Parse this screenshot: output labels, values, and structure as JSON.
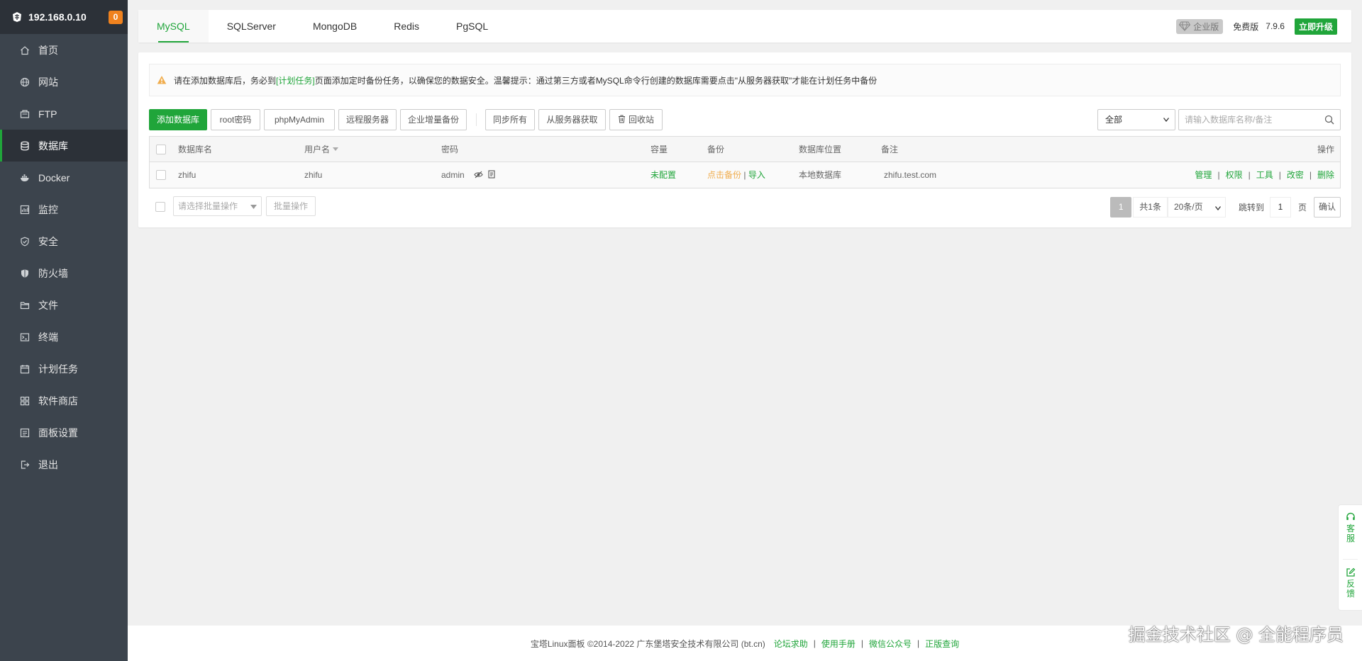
{
  "sidebar": {
    "ip": "192.168.0.10",
    "badge": "0",
    "items": [
      {
        "label": "首页",
        "icon": "home-icon"
      },
      {
        "label": "网站",
        "icon": "globe-icon"
      },
      {
        "label": "FTP",
        "icon": "ftp-icon"
      },
      {
        "label": "数据库",
        "icon": "database-icon",
        "active": true
      },
      {
        "label": "Docker",
        "icon": "docker-icon"
      },
      {
        "label": "监控",
        "icon": "monitor-icon"
      },
      {
        "label": "安全",
        "icon": "shield-icon"
      },
      {
        "label": "防火墙",
        "icon": "firewall-icon"
      },
      {
        "label": "文件",
        "icon": "folder-icon"
      },
      {
        "label": "终端",
        "icon": "terminal-icon"
      },
      {
        "label": "计划任务",
        "icon": "calendar-icon"
      },
      {
        "label": "软件商店",
        "icon": "apps-icon"
      },
      {
        "label": "面板设置",
        "icon": "settings-icon"
      },
      {
        "label": "退出",
        "icon": "logout-icon"
      }
    ]
  },
  "tabs": [
    "MySQL",
    "SQLServer",
    "MongoDB",
    "Redis",
    "PgSQL"
  ],
  "active_tab": "MySQL",
  "topbar": {
    "enterprise_label": "企业版",
    "free_label": "免费版",
    "version": "7.9.6",
    "upgrade_label": "立即升级"
  },
  "alert": {
    "text_before": "请在添加数据库后，务必到",
    "link": "[计划任务]",
    "text_after": "页面添加定时备份任务，以确保您的数据安全。温馨提示：通过第三方或者MySQL命令行创建的数据库需要点击\"从服务器获取\"才能在计划任务中备份"
  },
  "toolbar": {
    "add_db": "添加数据库",
    "root_pwd": "root密码",
    "phpmyadmin": "phpMyAdmin",
    "remote_server": "远程服务器",
    "enterprise_backup": "企业增量备份",
    "sync_all": "同步所有",
    "get_from_server": "从服务器获取",
    "recycle_bin": "回收站",
    "filter_value": "全部",
    "search_placeholder": "请输入数据库名称/备注"
  },
  "table": {
    "headers": {
      "name": "数据库名",
      "user": "用户名",
      "password": "密码",
      "capacity": "容量",
      "backup": "备份",
      "location": "数据库位置",
      "remark": "备注",
      "actions": "操作"
    },
    "rows": [
      {
        "name": "zhifu",
        "user": "zhifu",
        "password": "admin",
        "capacity": "未配置",
        "backup": "点击备份",
        "import": "导入",
        "location": "本地数据库",
        "remark": "zhifu.test.com",
        "ops": [
          "管理",
          "权限",
          "工具",
          "改密",
          "删除"
        ]
      }
    ]
  },
  "batch": {
    "select_placeholder": "请选择批量操作",
    "button": "批量操作"
  },
  "pager": {
    "current": "1",
    "total": "共1条",
    "page_size": "20条/页",
    "jump_label": "跳转到",
    "jump_value": "1",
    "unit": "页",
    "confirm": "确认"
  },
  "float": {
    "service": "客服",
    "feedback": "反馈"
  },
  "footer": {
    "copyright": "宝塔Linux面板 ©2014-2022 广东堡塔安全技术有限公司 (bt.cn)",
    "links": [
      "论坛求助",
      "使用手册",
      "微信公众号",
      "正版查询"
    ]
  },
  "watermark": "掘金技术社区 @ 全能程序员",
  "colors": {
    "accent": "#20a53a",
    "sidebar_bg": "#3c444d",
    "sidebar_active": "#2c3138",
    "badge": "#f0821e",
    "warning": "#f0ad4e"
  }
}
